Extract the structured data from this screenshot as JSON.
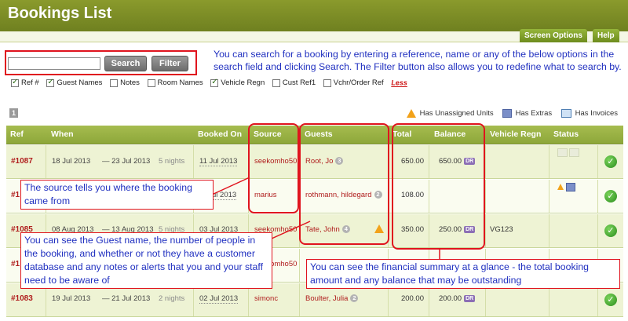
{
  "header": {
    "title": "Bookings List"
  },
  "tabs": {
    "screen_options": "Screen Options",
    "help": "Help"
  },
  "search": {
    "placeholder": "",
    "value": "",
    "search_label": "Search",
    "filter_label": "Filter"
  },
  "filters": [
    {
      "label": "Ref #",
      "checked": true
    },
    {
      "label": "Guest Names",
      "checked": true
    },
    {
      "label": "Notes",
      "checked": false
    },
    {
      "label": "Room Names",
      "checked": false
    },
    {
      "label": "Vehicle Regn",
      "checked": true
    },
    {
      "label": "Cust Ref1",
      "checked": false
    },
    {
      "label": "Vchr/Order Ref",
      "checked": false
    }
  ],
  "less_label": "Less",
  "pagination": {
    "current": "1"
  },
  "legend": {
    "unassigned": "Has Unassigned Units",
    "extras": "Has Extras",
    "invoices": "Has Invoices"
  },
  "columns": [
    "Ref",
    "When",
    "Booked On",
    "Source",
    "Guests",
    "Total",
    "Balance",
    "Vehicle Regn",
    "Status"
  ],
  "rows": [
    {
      "ref": "#1087",
      "from": "18 Jul 2013",
      "to": "— 23 Jul 2013",
      "nights": "5 nights",
      "booked": "11 Jul 2013",
      "source": "seekomho50",
      "guest": "Root, Jo",
      "pax": "3",
      "total": "650.00",
      "balance": "650.00",
      "dr": "DR",
      "vehicle": ""
    },
    {
      "ref": "#1",
      "from": "",
      "to": "",
      "nights": "",
      "booked": "ul 2013",
      "source": "marius",
      "guest": "rothmann, hildegard",
      "pax": "2",
      "total": "108.00",
      "balance": "",
      "dr": "",
      "vehicle": ""
    },
    {
      "ref": "#1085",
      "from": "08 Aug 2013",
      "to": "— 13 Aug 2013",
      "nights": "5 nights",
      "booked": "03 Jul 2013",
      "source": "seekomho50",
      "guest": "Tate, John",
      "pax": "4",
      "total": "350.00",
      "balance": "250.00",
      "dr": "DR",
      "vehicle": "VG123"
    },
    {
      "ref": "#1",
      "from": "",
      "to": "",
      "nights": "",
      "booked": "",
      "source": "seekomho50",
      "guest": "",
      "pax": "",
      "total": "",
      "balance": "",
      "dr": "",
      "vehicle": ""
    },
    {
      "ref": "#1083",
      "from": "19 Jul 2013",
      "to": "— 21 Jul 2013",
      "nights": "2 nights",
      "booked": "02 Jul 2013",
      "source": "simonc",
      "guest": "Boulter, Julia",
      "pax": "2",
      "total": "200.00",
      "balance": "200.00",
      "dr": "DR",
      "vehicle": ""
    }
  ],
  "notes": {
    "search": "You can search for a booking by entering a reference, name or any of the below options in the search field and clicking Search. The Filter button also allows you        to  redefine what to search by.",
    "source": "The source tells you where the booking came from",
    "guests": "You can see the Guest name, the number of people in the booking, and whether or not they have a customer database and any notes or alerts that you and your staff need to be aware of",
    "financial": "You can see the financial summary at a glance - the total booking amount and any balance that may be outstanding"
  },
  "colors": {
    "header": "#7f902a",
    "annotation_red": "#e0141e",
    "annotation_text": "#2030c0"
  }
}
